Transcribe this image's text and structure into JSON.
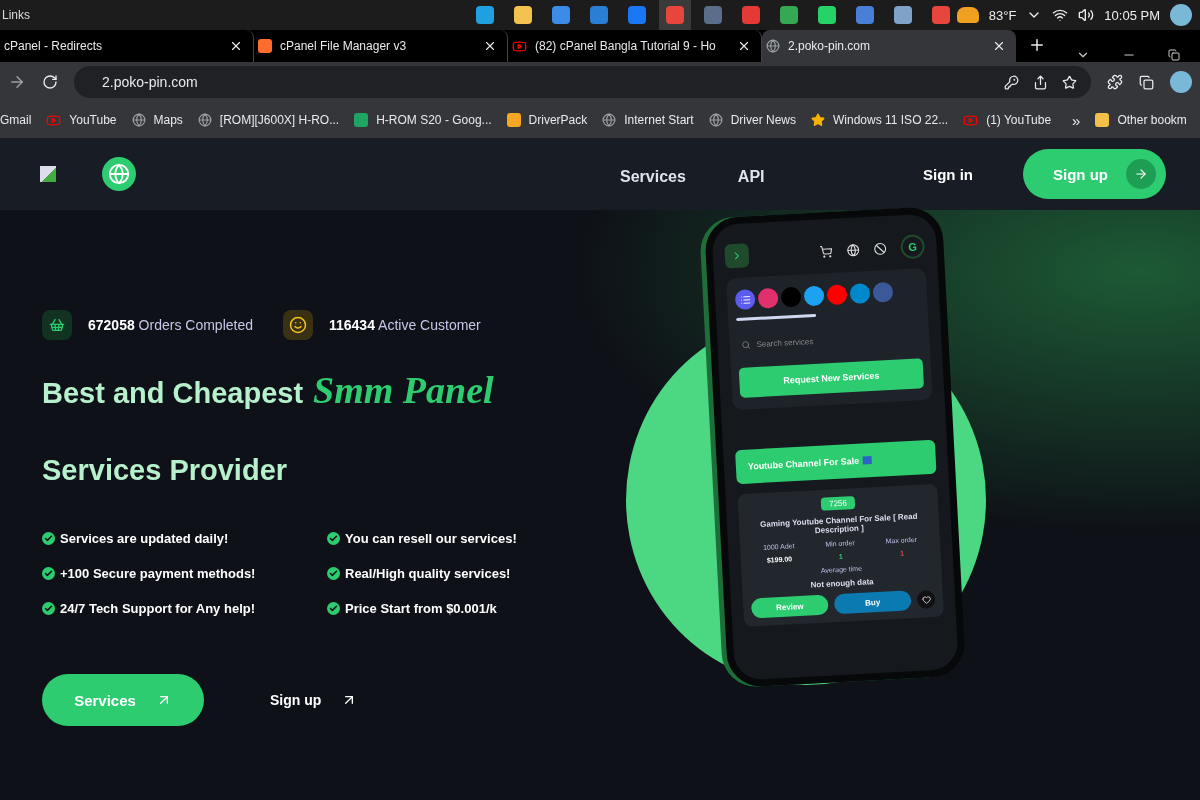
{
  "taskbar": {
    "label": "Links",
    "apps": [
      {
        "kind": "edge",
        "selected": false
      },
      {
        "kind": "folder",
        "selected": false
      },
      {
        "kind": "store",
        "selected": false
      },
      {
        "kind": "mail",
        "selected": false
      },
      {
        "kind": "facebook",
        "selected": false
      },
      {
        "kind": "chrome",
        "selected": true
      },
      {
        "kind": "film",
        "selected": false
      },
      {
        "kind": "anydesk",
        "selected": false
      },
      {
        "kind": "drive",
        "selected": false
      },
      {
        "kind": "whatsapp",
        "selected": false
      },
      {
        "kind": "code",
        "selected": false
      },
      {
        "kind": "photo",
        "selected": false
      },
      {
        "kind": "chrome",
        "selected": false
      }
    ],
    "weather": "83°F",
    "time": "10:05 PM"
  },
  "tabs": [
    {
      "title": "cPanel - Redirects",
      "kind": "none",
      "selected": false
    },
    {
      "title": "cPanel File Manager v3",
      "kind": "cpanel",
      "selected": false
    },
    {
      "title": "(82) cPanel Bangla Tutorial 9 - Ho",
      "kind": "youtube",
      "selected": false
    },
    {
      "title": "2.poko-pin.com",
      "kind": "globe",
      "selected": true
    }
  ],
  "address": "2.poko-pin.com",
  "bookmarks": [
    {
      "label": "Gmail",
      "kind": "none"
    },
    {
      "label": "YouTube",
      "kind": "youtube"
    },
    {
      "label": "Maps",
      "kind": "globe"
    },
    {
      "label": "[ROM][J600X] H-RO...",
      "kind": "globe"
    },
    {
      "label": "H-ROM S20 - Goog...",
      "kind": "drive"
    },
    {
      "label": "DriverPack",
      "kind": "driverpack"
    },
    {
      "label": "Internet Start",
      "kind": "globe"
    },
    {
      "label": "Driver News",
      "kind": "globe"
    },
    {
      "label": "Windows 11 ISO 22...",
      "kind": "star"
    },
    {
      "label": "(1) YouTube",
      "kind": "youtube"
    }
  ],
  "bookmarks_more": "»",
  "other_bookmarks": "Other bookm",
  "nav": {
    "links": [
      "Services",
      "API"
    ],
    "sign_in": "Sign in",
    "sign_up": "Sign up"
  },
  "stats": [
    {
      "kind": "basket",
      "value": "672058",
      "label": "Orders Completed"
    },
    {
      "kind": "smile",
      "value": "116434",
      "label": "Active Customer"
    }
  ],
  "headline": {
    "lead": "Best and Cheapest",
    "script": "Smm Panel",
    "second": "Services Provider"
  },
  "features": [
    "Services are updated daily!",
    "You can resell our services!",
    "+100 Secure payment methods!",
    "Real/High quality services!",
    "24/7 Tech Support for Any help!",
    "Price Start from $0.001/k"
  ],
  "buttons": {
    "primary": "Services",
    "secondary": "Sign up"
  },
  "phone": {
    "avatar": "G",
    "socials": [
      {
        "kind": "list"
      },
      {
        "kind": "instagram"
      },
      {
        "kind": "tiktok"
      },
      {
        "kind": "twitter"
      },
      {
        "kind": "youtube"
      },
      {
        "kind": "telegram"
      },
      {
        "kind": "facebook"
      }
    ],
    "search": "Search services",
    "request": "Request New Services",
    "banner": "Youtube Channel For Sale",
    "card": {
      "id": "7256",
      "title": "Gaming Youtube Channel For Sale [ Read Description ]",
      "quantity": "1000 Adet",
      "price": "$199.00",
      "min_label": "Min order",
      "min": "1",
      "max_label": "Max order",
      "max": "1",
      "avg_label": "Average time",
      "avg": "Not enough data",
      "review": "Review",
      "buy": "Buy"
    }
  }
}
